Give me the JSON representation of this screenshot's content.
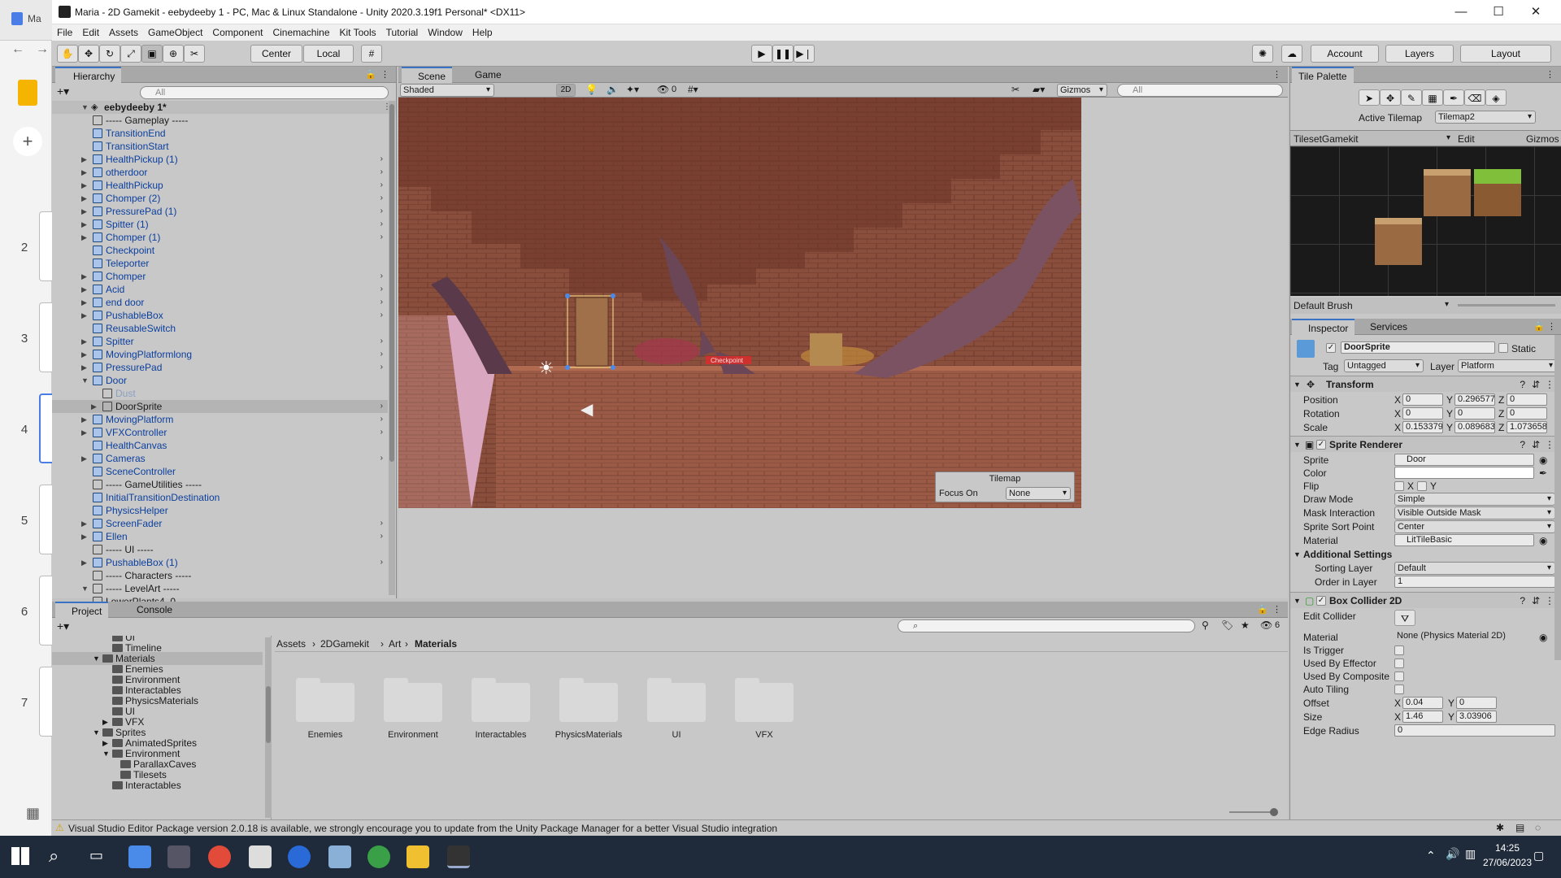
{
  "background_app": {
    "slide_numbers": [
      "2",
      "3",
      "4",
      "5",
      "6",
      "7"
    ],
    "tab_label": "Ma"
  },
  "window": {
    "title": "Maria - 2D Gamekit - eebydeeby 1 - PC, Mac & Linux Standalone - Unity 2020.3.19f1 Personal* <DX11>",
    "minimize": "—",
    "maximize": "☐",
    "close": "✕"
  },
  "menu": [
    "File",
    "Edit",
    "Assets",
    "GameObject",
    "Component",
    "Cinemachine",
    "Kit Tools",
    "Tutorial",
    "Window",
    "Help"
  ],
  "toolbar": {
    "pivot": "Center",
    "space": "Local",
    "account": "Account",
    "layers": "Layers",
    "layout": "Layout"
  },
  "hierarchy": {
    "tab": "Hierarchy",
    "search_placeholder": "All",
    "scene_name": "eebydeeby 1*",
    "items": [
      {
        "label": "----- Gameplay -----",
        "prefab": false,
        "arrow": "",
        "depth": 1
      },
      {
        "label": "TransitionEnd",
        "prefab": true,
        "arrow": "",
        "depth": 1
      },
      {
        "label": "TransitionStart",
        "prefab": true,
        "arrow": "",
        "depth": 1
      },
      {
        "label": "HealthPickup (1)",
        "prefab": true,
        "arrow": "▶",
        "depth": 1
      },
      {
        "label": "otherdoor",
        "prefab": true,
        "arrow": "▶",
        "depth": 1
      },
      {
        "label": "HealthPickup",
        "prefab": true,
        "arrow": "▶",
        "depth": 1
      },
      {
        "label": "Chomper (2)",
        "prefab": true,
        "arrow": "▶",
        "depth": 1
      },
      {
        "label": "PressurePad (1)",
        "prefab": true,
        "arrow": "▶",
        "depth": 1
      },
      {
        "label": "Spitter (1)",
        "prefab": true,
        "arrow": "▶",
        "depth": 1
      },
      {
        "label": "Chomper (1)",
        "prefab": true,
        "arrow": "▶",
        "depth": 1
      },
      {
        "label": "Checkpoint",
        "prefab": true,
        "arrow": "",
        "depth": 1
      },
      {
        "label": "Teleporter",
        "prefab": true,
        "arrow": "",
        "depth": 1
      },
      {
        "label": "Chomper",
        "prefab": true,
        "arrow": "▶",
        "depth": 1
      },
      {
        "label": "Acid",
        "prefab": true,
        "arrow": "▶",
        "depth": 1
      },
      {
        "label": "end door",
        "prefab": true,
        "arrow": "▶",
        "depth": 1
      },
      {
        "label": "PushableBox",
        "prefab": true,
        "arrow": "▶",
        "depth": 1
      },
      {
        "label": "ReusableSwitch",
        "prefab": true,
        "arrow": "",
        "depth": 1
      },
      {
        "label": "Spitter",
        "prefab": true,
        "arrow": "▶",
        "depth": 1
      },
      {
        "label": "MovingPlatformlong",
        "prefab": true,
        "arrow": "▶",
        "depth": 1
      },
      {
        "label": "PressurePad",
        "prefab": true,
        "arrow": "▶",
        "depth": 1
      },
      {
        "label": "Door",
        "prefab": true,
        "arrow": "▼",
        "depth": 1
      },
      {
        "label": "Dust",
        "prefab": false,
        "arrow": "",
        "depth": 2,
        "dim": true
      },
      {
        "label": "DoorSprite",
        "prefab": false,
        "arrow": "▶",
        "depth": 2,
        "selected": true
      },
      {
        "label": "MovingPlatform",
        "prefab": true,
        "arrow": "▶",
        "depth": 1
      },
      {
        "label": "VFXController",
        "prefab": true,
        "arrow": "▶",
        "depth": 1
      },
      {
        "label": "HealthCanvas",
        "prefab": true,
        "arrow": "",
        "depth": 1
      },
      {
        "label": "Cameras",
        "prefab": true,
        "arrow": "▶",
        "depth": 1
      },
      {
        "label": "SceneController",
        "prefab": true,
        "arrow": "",
        "depth": 1
      },
      {
        "label": "----- GameUtilities -----",
        "prefab": false,
        "arrow": "",
        "depth": 1
      },
      {
        "label": "InitialTransitionDestination",
        "prefab": true,
        "arrow": "",
        "depth": 1
      },
      {
        "label": "PhysicsHelper",
        "prefab": true,
        "arrow": "",
        "depth": 1
      },
      {
        "label": "ScreenFader",
        "prefab": true,
        "arrow": "▶",
        "depth": 1
      },
      {
        "label": "Ellen",
        "prefab": true,
        "arrow": "▶",
        "depth": 1
      },
      {
        "label": "----- UI -----",
        "prefab": false,
        "arrow": "",
        "depth": 1
      },
      {
        "label": "PushableBox (1)",
        "prefab": true,
        "arrow": "▶",
        "depth": 1
      },
      {
        "label": "----- Characters -----",
        "prefab": false,
        "arrow": "",
        "depth": 1
      },
      {
        "label": "----- LevelArt -----",
        "prefab": false,
        "arrow": "▼",
        "depth": 1
      },
      {
        "label": "LowerPlants4_0",
        "prefab": false,
        "arrow": "",
        "depth": 1
      }
    ]
  },
  "scene": {
    "tabs": [
      "Scene",
      "Game"
    ],
    "shading": "Shaded",
    "mode_2d": "2D",
    "hidden_count": "0",
    "gizmos": "Gizmos",
    "search_placeholder": "All",
    "checkpoint_label": "Checkpoint",
    "overlay": {
      "title": "Tilemap",
      "focus_label": "Focus On",
      "focus_value": "None"
    }
  },
  "tile_palette": {
    "tab": "Tile Palette",
    "active_tilemap_label": "Active Tilemap",
    "active_tilemap": "Tilemap2",
    "palette": "TilesetGamekit",
    "edit": "Edit",
    "gizmos": "Gizmos",
    "brush": "Default Brush"
  },
  "inspector": {
    "tabs": [
      "Inspector",
      "Services"
    ],
    "object_name": "DoorSprite",
    "static_label": "Static",
    "tag_label": "Tag",
    "tag": "Untagged",
    "layer_label": "Layer",
    "layer": "Platform",
    "transform": {
      "title": "Transform",
      "position": {
        "label": "Position",
        "x": "0",
        "y": "0.296577",
        "z": "0"
      },
      "rotation": {
        "label": "Rotation",
        "x": "0",
        "y": "0",
        "z": "0"
      },
      "scale": {
        "label": "Scale",
        "x": "0.153379",
        "y": "0.089683",
        "z": "1.073658"
      }
    },
    "sprite_renderer": {
      "title": "Sprite Renderer",
      "sprite_label": "Sprite",
      "sprite": "Door",
      "color_label": "Color",
      "flip_label": "Flip",
      "flip_x": "X",
      "flip_y": "Y",
      "draw_mode_label": "Draw Mode",
      "draw_mode": "Simple",
      "mask_label": "Mask Interaction",
      "mask": "Visible Outside Mask",
      "sort_point_label": "Sprite Sort Point",
      "sort_point": "Center",
      "material_label": "Material",
      "material": "LitTileBasic",
      "additional": "Additional Settings",
      "sorting_layer_label": "Sorting Layer",
      "sorting_layer": "Default",
      "order_label": "Order in Layer",
      "order": "1"
    },
    "box_collider": {
      "title": "Box Collider 2D",
      "edit_label": "Edit Collider",
      "material_label": "Material",
      "material": "None (Physics Material 2D)",
      "is_trigger": "Is Trigger",
      "effector": "Used By Effector",
      "composite": "Used By Composite",
      "auto_tiling": "Auto Tiling",
      "offset_label": "Offset",
      "offset_x": "0.04",
      "offset_y": "0",
      "size_label": "Size",
      "size_x": "1.46",
      "size_y": "3.03906",
      "edge_label": "Edge Radius",
      "edge": "0"
    }
  },
  "project": {
    "tabs": [
      "Project",
      "Console"
    ],
    "hidden_count": "6",
    "breadcrumb": [
      "Assets",
      "2DGamekit",
      "Art",
      "Materials"
    ],
    "tree": [
      {
        "label": "UI",
        "depth": 2,
        "arrow": ""
      },
      {
        "label": "Timeline",
        "depth": 2,
        "arrow": ""
      },
      {
        "label": "Materials",
        "depth": 1,
        "arrow": "▼",
        "selected": true
      },
      {
        "label": "Enemies",
        "depth": 2,
        "arrow": ""
      },
      {
        "label": "Environment",
        "depth": 2,
        "arrow": ""
      },
      {
        "label": "Interactables",
        "depth": 2,
        "arrow": ""
      },
      {
        "label": "PhysicsMaterials",
        "depth": 2,
        "arrow": ""
      },
      {
        "label": "UI",
        "depth": 2,
        "arrow": ""
      },
      {
        "label": "VFX",
        "depth": 2,
        "arrow": "▶"
      },
      {
        "label": "Sprites",
        "depth": 1,
        "arrow": "▼"
      },
      {
        "label": "AnimatedSprites",
        "depth": 2,
        "arrow": "▶"
      },
      {
        "label": "Environment",
        "depth": 2,
        "arrow": "▼"
      },
      {
        "label": "ParallaxCaves",
        "depth": 3,
        "arrow": ""
      },
      {
        "label": "Tilesets",
        "depth": 3,
        "arrow": ""
      },
      {
        "label": "Interactables",
        "depth": 2,
        "arrow": ""
      }
    ],
    "folders": [
      "Enemies",
      "Environment",
      "Interactables",
      "PhysicsMaterials",
      "UI",
      "VFX"
    ]
  },
  "status": {
    "message": "Visual Studio Editor Package version 2.0.18 is available, we strongly encourage you to update from the Unity Package Manager for a better Visual Studio integration"
  },
  "taskbar": {
    "time": "14:25",
    "date": "27/06/2023"
  }
}
